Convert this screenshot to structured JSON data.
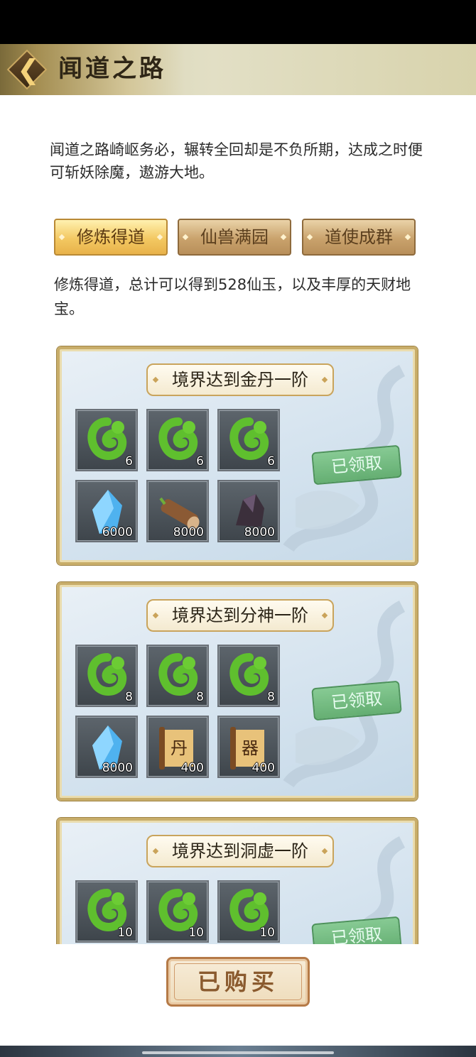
{
  "header": {
    "title": "闻道之路",
    "back_icon": "chevron-left-icon"
  },
  "intro": "闻道之路崎岖务必，辗转全回却是不负所期，达成之时便可斩妖除魔，遨游大地。",
  "tabs": [
    {
      "label": "修炼得道",
      "active": true
    },
    {
      "label": "仙兽满园",
      "active": false
    },
    {
      "label": "道使成群",
      "active": false
    }
  ],
  "tab_description": "修炼得道，总计可以得到528仙玉，以及丰厚的天财地宝。",
  "rewards": [
    {
      "title": "境界达到金丹一阶",
      "status": "已领取",
      "items": [
        {
          "icon": "green-jade-dragon-icon",
          "qty": "6"
        },
        {
          "icon": "green-jade-dragon-icon",
          "qty": "6"
        },
        {
          "icon": "green-jade-dragon-icon",
          "qty": "6"
        },
        {
          "icon": "blue-crystal-icon",
          "qty": "6000"
        },
        {
          "icon": "wood-log-icon",
          "qty": "8000"
        },
        {
          "icon": "dark-ore-icon",
          "qty": "8000"
        }
      ]
    },
    {
      "title": "境界达到分神一阶",
      "status": "已领取",
      "items": [
        {
          "icon": "green-jade-dragon-icon",
          "qty": "8"
        },
        {
          "icon": "green-jade-dragon-icon",
          "qty": "8"
        },
        {
          "icon": "green-jade-dragon-icon",
          "qty": "8"
        },
        {
          "icon": "blue-crystal-icon",
          "qty": "8000"
        },
        {
          "icon": "scroll-icon",
          "qty": "400",
          "glyph": "丹"
        },
        {
          "icon": "scroll-icon",
          "qty": "400",
          "glyph": "器"
        }
      ]
    },
    {
      "title": "境界达到洞虚一阶",
      "status": "已领取",
      "items": [
        {
          "icon": "green-jade-dragon-icon",
          "qty": "10"
        },
        {
          "icon": "green-jade-dragon-icon",
          "qty": "10"
        },
        {
          "icon": "green-jade-dragon-icon",
          "qty": "10"
        }
      ]
    }
  ],
  "buy_button": "已购买",
  "colors": {
    "accent_gold": "#c8ad6a",
    "claimed_green": "#5aaa66",
    "card_bg": "#d3e2ee"
  }
}
